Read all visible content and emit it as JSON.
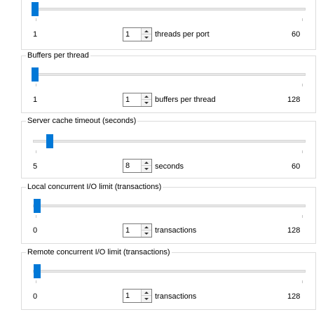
{
  "groups": [
    {
      "id": "threads",
      "title": "",
      "min": "1",
      "max": "60",
      "value": "1",
      "unit": "threads per port",
      "level": 0
    },
    {
      "id": "buffers",
      "title": "Buffers per thread",
      "min": "1",
      "max": "128",
      "value": "1",
      "unit": "buffers per thread",
      "level": 0
    },
    {
      "id": "cache",
      "title": "Server cache timeout (seconds)",
      "min": "5",
      "max": "60",
      "value": "8",
      "unit": "seconds",
      "level": 0.055
    },
    {
      "id": "local",
      "title": "Local concurrent I/O limit (transactions)",
      "min": "0",
      "max": "128",
      "value": "1",
      "unit": "transactions",
      "level": 0.008
    },
    {
      "id": "remote",
      "title": "Remote concurrent I/O limit (transactions)",
      "min": "0",
      "max": "128",
      "value": "1",
      "unit": "transactions",
      "level": 0.008
    }
  ],
  "colors": {
    "thumb": "#0078d7",
    "group_border": "#dcdcdc",
    "track": "#e7e7e7"
  }
}
